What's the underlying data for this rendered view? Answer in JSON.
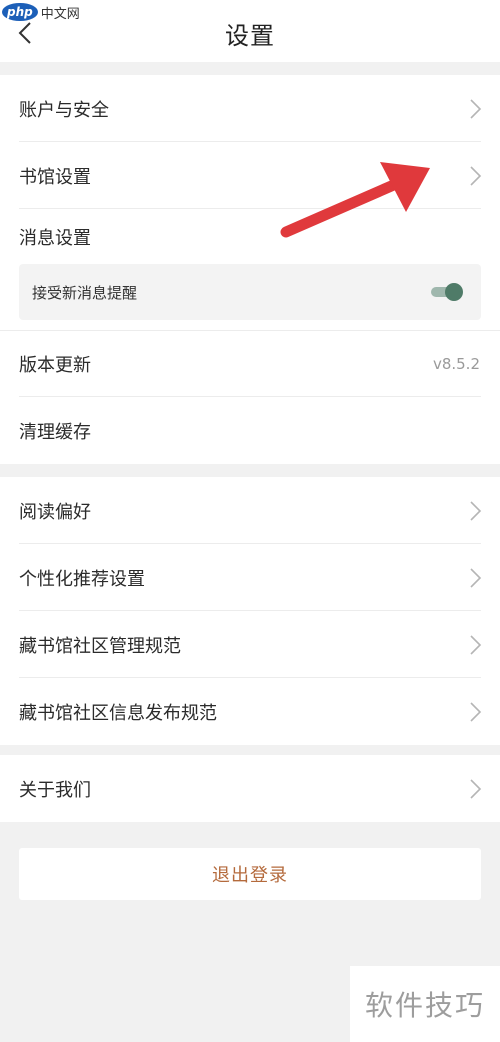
{
  "watermark": {
    "logo_badge": "php",
    "logo_text": "中文网",
    "bottom_text": "软件技巧"
  },
  "header": {
    "title": "设置",
    "back_icon": "chevron-left-icon"
  },
  "groups": [
    {
      "items": [
        {
          "label": "账户与安全",
          "right": "chevron-right-icon"
        },
        {
          "label": "书馆设置",
          "right": "chevron-right-icon"
        },
        {
          "label": "消息设置"
        },
        {
          "sub_label": "接受新消息提醒",
          "toggle_on": true
        },
        {
          "label": "版本更新",
          "value": "v8.5.2"
        },
        {
          "label": "清理缓存"
        }
      ]
    },
    {
      "items": [
        {
          "label": "阅读偏好",
          "right": "chevron-right-icon"
        },
        {
          "label": "个性化推荐设置",
          "right": "chevron-right-icon"
        },
        {
          "label": "藏书馆社区管理规范",
          "right": "chevron-right-icon"
        },
        {
          "label": "藏书馆社区信息发布规范",
          "right": "chevron-right-icon"
        }
      ]
    },
    {
      "items": [
        {
          "label": "关于我们",
          "right": "chevron-right-icon"
        }
      ]
    }
  ],
  "logout": {
    "label": "退出登录"
  },
  "colors": {
    "toggle_on": "#4f7b68",
    "logout_text": "#b46a3c",
    "annotation_arrow": "#e0393c"
  }
}
